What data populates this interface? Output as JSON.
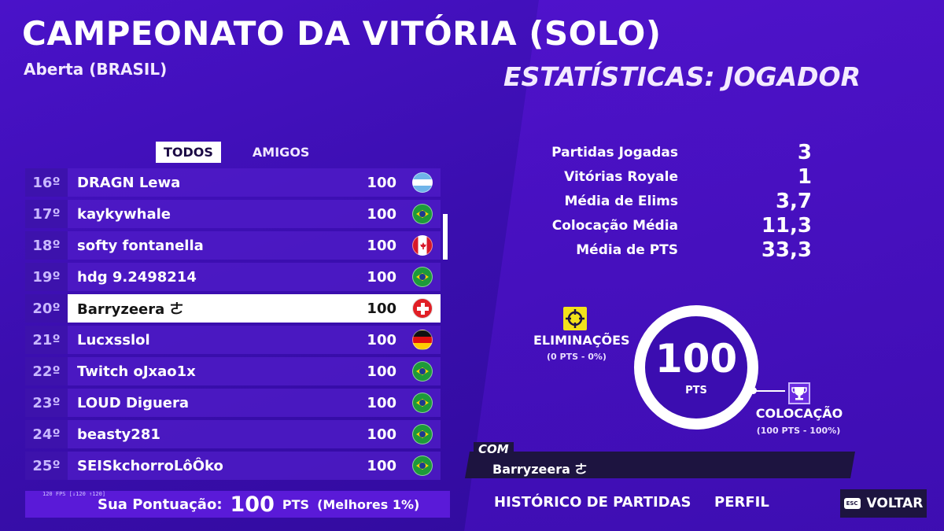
{
  "header": {
    "title": "CAMPEONATO DA VITÓRIA (SOLO)",
    "subtitle": "Aberta (BRASIL)",
    "stats_heading": "ESTATÍSTICAS: JOGADOR"
  },
  "tabs": [
    {
      "label": "TODOS",
      "active": true
    },
    {
      "label": "AMIGOS",
      "active": false
    }
  ],
  "leaderboard": {
    "rows": [
      {
        "rank": "16º",
        "name": "DRAGN Lewa",
        "score": "100",
        "flag": "flag-argentina-icon"
      },
      {
        "rank": "17º",
        "name": "kaykywhale",
        "score": "100",
        "flag": "flag-brazil-icon"
      },
      {
        "rank": "18º",
        "name": "softy fontanella",
        "score": "100",
        "flag": "flag-canada-icon"
      },
      {
        "rank": "19º",
        "name": "hdg 9.2498214",
        "score": "100",
        "flag": "flag-brazil-icon"
      },
      {
        "rank": "20º",
        "name": "Barryzeera ㄜ",
        "score": "100",
        "flag": "flag-switzerland-icon"
      },
      {
        "rank": "21º",
        "name": "Lucxsslol",
        "score": "100",
        "flag": "flag-germany-icon"
      },
      {
        "rank": "22º",
        "name": "Twitch oJxao1x",
        "score": "100",
        "flag": "flag-brazil-icon"
      },
      {
        "rank": "23º",
        "name": "LOUD Diguera",
        "score": "100",
        "flag": "flag-brazil-icon"
      },
      {
        "rank": "24º",
        "name": "beasty281",
        "score": "100",
        "flag": "flag-brazil-icon"
      },
      {
        "rank": "25º",
        "name": "SEISkchorroLôÔko",
        "score": "100",
        "flag": "flag-brazil-icon"
      }
    ],
    "highlighted_rank": "20º"
  },
  "your_score": {
    "label": "Sua Pontuação:",
    "value": "100",
    "unit": "PTS",
    "percentile": "(Melhores 1%)"
  },
  "fps_overlay": "120 FPS [↓120 ↑120]",
  "stats": [
    {
      "label": "Partidas Jogadas",
      "value": "3"
    },
    {
      "label": "Vitórias Royale",
      "value": "1"
    },
    {
      "label": "Média de Elims",
      "value": "3,7"
    },
    {
      "label": "Colocação Média",
      "value": "11,3"
    },
    {
      "label": "Média de PTS",
      "value": "33,3"
    }
  ],
  "points_breakdown": {
    "total": "100",
    "total_unit": "PTS",
    "eliminations_label": "ELIMINAÇÕES",
    "eliminations_sub": "(0 PTS - 0%)",
    "placement_label": "COLOCAÇÃO",
    "placement_sub": "(100 PTS - 100%)"
  },
  "teammate": {
    "tag": "COM",
    "name": "Barryzeera ㄜ"
  },
  "bottom_nav": {
    "history": "HISTÓRICO DE PARTIDAS",
    "profile": "PERFIL",
    "back": "VOLTAR",
    "esc": "ESC"
  },
  "colors": {
    "background": "#3b0fb0",
    "highlight_row": "#ffffff",
    "elim_icon": "#f3e21a"
  }
}
